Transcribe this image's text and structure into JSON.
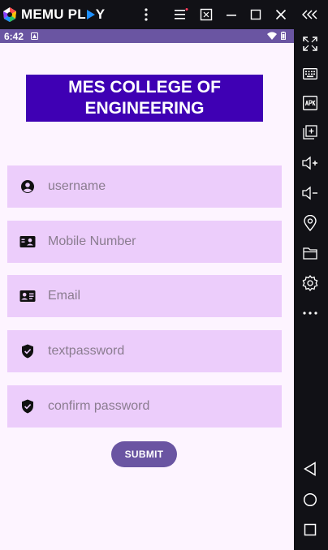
{
  "emulator": {
    "brand": "MEMU PLAY",
    "brand_part1": "MEMU PL",
    "brand_part2": "Y",
    "accent_colors": [
      "#ff4d4d",
      "#ffc300",
      "#25c36a",
      "#1e90ff"
    ],
    "titlebar_controls": [
      "more-vert",
      "menu",
      "screen-toggle",
      "minimize",
      "maximize",
      "close",
      "collapse-sidebar"
    ],
    "sidebar_tools": [
      "fullscreen",
      "keyboard",
      "apk-install",
      "multi-instance",
      "volume-up",
      "volume-down",
      "location",
      "shared-folder",
      "settings",
      "more"
    ],
    "nav_buttons": [
      "back",
      "home",
      "recent-apps"
    ]
  },
  "statusbar": {
    "time": "6:42",
    "color": "#6a55a2"
  },
  "app": {
    "header_title": "MES COLLEGE OF ENGINEERING",
    "header_color": "#3f00b4",
    "field_background": "#eccdfb",
    "fields": [
      {
        "icon": "account-circle-icon",
        "placeholder": "username",
        "value": ""
      },
      {
        "icon": "contact-card-icon",
        "placeholder": "Mobile Number",
        "value": ""
      },
      {
        "icon": "contact-mail-icon",
        "placeholder": "Email",
        "value": ""
      },
      {
        "icon": "shield-check-icon",
        "placeholder": "textpassword",
        "value": ""
      },
      {
        "icon": "shield-check-icon",
        "placeholder": "confirm password",
        "value": ""
      }
    ],
    "submit_label": "SUBMIT",
    "submit_color": "#6a55a2"
  }
}
